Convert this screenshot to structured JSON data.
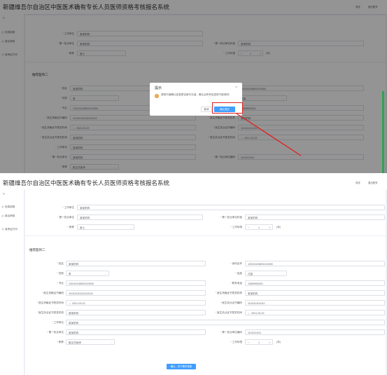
{
  "app": {
    "title": "新疆维吾尔自治区中医医术确有专长人员医师资格考核报名系统",
    "top_link_1": "测试",
    "top_link_2": "退出账号"
  },
  "sidebar": {
    "items": [
      {
        "icon": "circle-icon",
        "glyph": "◎",
        "label": "信息填报"
      },
      {
        "icon": "circle-icon",
        "glyph": "◎",
        "label": "报名审核"
      },
      {
        "icon": "print-icon",
        "glyph": "⎙",
        "label": "准考证打印"
      }
    ]
  },
  "bottom": {
    "top_fields": {
      "work_unit": {
        "label": "工作单位",
        "value": "某某机构"
      },
      "practice_place": {
        "label": "第一执业单位",
        "value": "某某机构"
      },
      "practice_place_2": {
        "label": "第一执业单位科室",
        "value": "某某机构"
      },
      "title_select": {
        "label": "职称",
        "value": "医士"
      },
      "work_years": {
        "label": "工作年限",
        "value": "1",
        "unit": "(年)",
        "minus": "−",
        "plus": "+"
      }
    },
    "section_title": "推荐医师二",
    "fields": {
      "name": {
        "label": "姓名",
        "value": "某某机构"
      },
      "id_no": {
        "label": "身份证号",
        "value": "120101198001010000"
      },
      "gender": {
        "label": "性别",
        "value": "男"
      },
      "ethnic": {
        "label": "民族",
        "value": "汉族"
      },
      "major": {
        "label": "专业",
        "value": "120101198001010000"
      },
      "phone": {
        "label": "联系电话",
        "value": "13699994321"
      },
      "cert_no": {
        "label": "医生资格证书编码",
        "value": "11111111111111111111"
      },
      "cert_org": {
        "label": "医生资格证书签发机构",
        "value": "某某机构"
      },
      "cert_date": {
        "label": "医生资格证书签发时间",
        "value": "2021-03-22"
      },
      "license_no": {
        "label": "医生执业证书编码",
        "value": "11111111111111"
      },
      "license_org": {
        "label": "医生执业证书签发机构",
        "value": "某某机构"
      },
      "license_date": {
        "label": "医生执业证书签发时间",
        "value": "2021-03-22"
      },
      "work_unit": {
        "label": "工作单位",
        "value": "某某机构"
      },
      "practice_place": {
        "label": "第一执业单位",
        "value": "某某机构"
      },
      "practice_unit_no": {
        "label": "第一执业单位编码",
        "value": "11111111111"
      },
      "title_select": {
        "label": "职称",
        "value": "副主任医师"
      },
      "work_years": {
        "label": "工作年限",
        "value": "1",
        "unit": "(年)",
        "minus": "−",
        "plus": "+"
      }
    },
    "submit_label": "确认，完下载申请表"
  },
  "top": {
    "rows": [
      {
        "label": "工作单位",
        "value": "某某机构"
      },
      {
        "label": "第一执业单位",
        "value": "某某机构",
        "label2": "第一执业单位科室",
        "value2": "某某机构"
      },
      {
        "label": "职称",
        "value": "医士",
        "label2": "工作年限",
        "value2": "1",
        "unit": "(年)"
      }
    ],
    "section_title": "推荐医师二",
    "fields": [
      {
        "label": "姓名",
        "value": "某某机构",
        "label2": "身份证号",
        "value2": "120101198001010000"
      },
      {
        "label": "性别",
        "value": "男",
        "label2": "民族",
        "value2": "汉族"
      },
      {
        "label": "专业",
        "value": "120101198001010000",
        "label2": "联系电话",
        "value2": "13699994321"
      },
      {
        "label": "医生资格证书编码",
        "value": "11111111111111111111",
        "label2": "医生资格证书签发机构",
        "value2": "某某机构"
      },
      {
        "label": "医生资格证书签发时间",
        "value": "2021-03-22",
        "label2": "医生执业证书编码",
        "value2": "11111111111111"
      },
      {
        "label": "医生执业证书签发机构",
        "value": "某某机构",
        "label2": "医生执业证书签发时间",
        "value2": "2021-03-22"
      },
      {
        "label": "工作单位",
        "value": "某某机构"
      },
      {
        "label": "第一执业单位",
        "value": "某某机构",
        "label2": "第一执业单位编码",
        "value2": "11111111111"
      },
      {
        "label": "职称",
        "value": "副主任医师"
      }
    ]
  },
  "dialog": {
    "title": "提示",
    "close": "×",
    "warn_glyph": "!",
    "message": "请您仔细确认信息是否填写无误，确认后所有信息将不能修改!",
    "cancel_label": "取消",
    "ok_label": "确认提交"
  },
  "colors": {
    "primary": "#409eff",
    "highlight": "#e02020",
    "warning": "#e6a23c"
  }
}
